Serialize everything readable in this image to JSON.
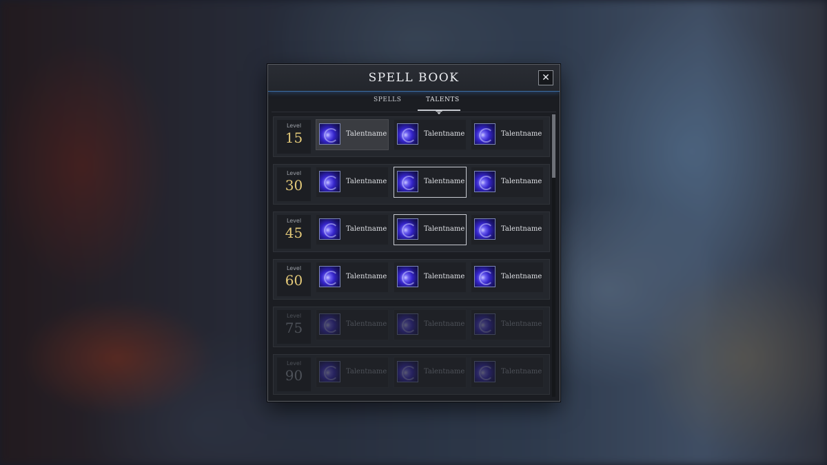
{
  "window": {
    "title": "SPELL BOOK",
    "close_symbol": "✕"
  },
  "tabs": [
    {
      "label": "SPELLS",
      "active": false
    },
    {
      "label": "TALENTS",
      "active": true
    }
  ],
  "rows": [
    {
      "level_label": "Level",
      "level": "15",
      "locked": false,
      "talents": [
        {
          "name": "Talentname",
          "state": "hovered"
        },
        {
          "name": "Talentname",
          "state": "normal"
        },
        {
          "name": "Talentname",
          "state": "normal"
        }
      ]
    },
    {
      "level_label": "Level",
      "level": "30",
      "locked": false,
      "talents": [
        {
          "name": "Talentname",
          "state": "normal"
        },
        {
          "name": "Talentname",
          "state": "selected"
        },
        {
          "name": "Talentname",
          "state": "normal"
        }
      ]
    },
    {
      "level_label": "Level",
      "level": "45",
      "locked": false,
      "talents": [
        {
          "name": "Talentname",
          "state": "normal"
        },
        {
          "name": "Talentname",
          "state": "selected"
        },
        {
          "name": "Talentname",
          "state": "normal"
        }
      ]
    },
    {
      "level_label": "Level",
      "level": "60",
      "locked": false,
      "talents": [
        {
          "name": "Talentname",
          "state": "normal"
        },
        {
          "name": "Talentname",
          "state": "normal"
        },
        {
          "name": "Talentname",
          "state": "normal"
        }
      ]
    },
    {
      "level_label": "Level",
      "level": "75",
      "locked": true,
      "talents": [
        {
          "name": "Talentname",
          "state": "locked"
        },
        {
          "name": "Talentname",
          "state": "locked"
        },
        {
          "name": "Talentname",
          "state": "locked"
        }
      ]
    },
    {
      "level_label": "Level",
      "level": "90",
      "locked": true,
      "talents": [
        {
          "name": "Talentname",
          "state": "locked"
        },
        {
          "name": "Talentname",
          "state": "locked"
        },
        {
          "name": "Talentname",
          "state": "locked"
        }
      ]
    }
  ],
  "icons": {
    "talent": "arcane-orb-icon",
    "close": "close-icon"
  },
  "colors": {
    "accent": "#3b6ea6",
    "level_gold": "#e3c979",
    "locked_text": "#4d5158"
  }
}
